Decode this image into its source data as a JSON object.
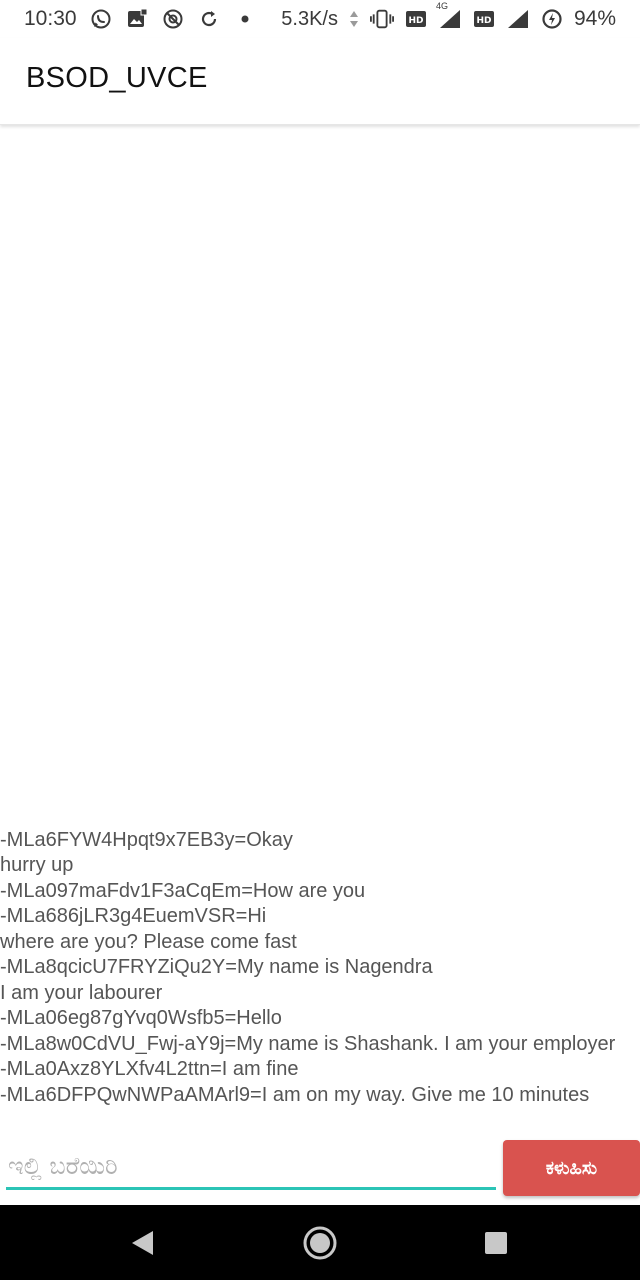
{
  "status_bar": {
    "time": "10:30",
    "speed": "5.3K/s",
    "network_label": "4G",
    "battery": "94%",
    "icons_left": [
      "whatsapp-icon",
      "gallery-notification-icon",
      "at-sign-icon",
      "sync-icon",
      "dot-icon"
    ],
    "icons_right": [
      "data-arrows-icon",
      "vibrate-icon",
      "hd-icon",
      "signal-icon",
      "hd-icon",
      "signal-icon",
      "battery-saver-icon"
    ]
  },
  "app_bar": {
    "title": "BSOD_UVCE"
  },
  "messages": [
    "-MLa6FYW4Hpqt9x7EB3y=Okay\nhurry up",
    "-MLa097maFdv1F3aCqEm=How are you",
    "-MLa686jLR3g4EuemVSR=Hi\nwhere are you? Please come fast",
    "-MLa8qcicU7FRYZiQu2Y=My name is Nagendra\nI am your labourer",
    "-MLa06eg87gYvq0Wsfb5=Hello",
    "-MLa8w0CdVU_Fwj-aY9j=My name is Shashank. I am your employer",
    "-MLa0Axz8YLXfv4L2ttn=I am fine",
    "-MLa6DFPQwNWPaAMArl9=I am on my way. Give me 10 minutes"
  ],
  "composer": {
    "placeholder": "ಇಲ್ಲಿ ಬರೆಯಿರಿ",
    "value": "",
    "send_label": "ಕಳುಹಿಸು",
    "accent_color": "#2bc4b6",
    "send_color": "#d9534f"
  },
  "nav_bar": {
    "buttons": [
      "back-icon",
      "home-icon",
      "recents-icon"
    ]
  }
}
